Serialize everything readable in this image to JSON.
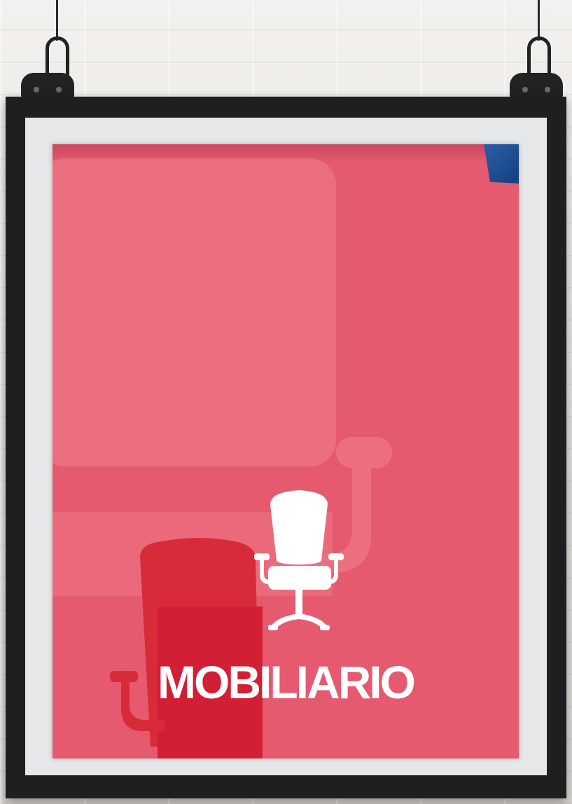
{
  "poster": {
    "title": "MOBILIARIO",
    "icon": "office-chair-icon",
    "background_color": "#e55a6f",
    "frame_color": "#1f1f1f",
    "mat_color": "#e6e7e8",
    "corner_fold_color": "#1e4d92"
  }
}
